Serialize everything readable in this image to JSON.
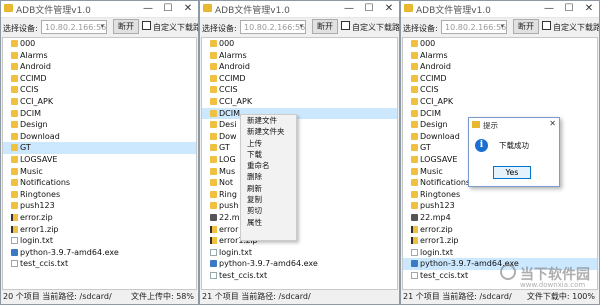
{
  "windows": [
    {
      "title": "ADB文件管理v1.0",
      "device_label": "选择设备:",
      "device_value": "10.80.2.166:5656",
      "disconnect_label": "断开",
      "custom_path_label": "自定义下载路径",
      "items": [
        {
          "name": "000",
          "type": "folder"
        },
        {
          "name": "Alarms",
          "type": "folder"
        },
        {
          "name": "Android",
          "type": "folder"
        },
        {
          "name": "CCIMD",
          "type": "folder"
        },
        {
          "name": "CCIS",
          "type": "folder"
        },
        {
          "name": "CCI_APK",
          "type": "folder"
        },
        {
          "name": "DCIM",
          "type": "folder"
        },
        {
          "name": "Design",
          "type": "folder"
        },
        {
          "name": "Download",
          "type": "folder"
        },
        {
          "name": "GT",
          "type": "folder",
          "selected": true
        },
        {
          "name": "LOGSAVE",
          "type": "folder"
        },
        {
          "name": "Music",
          "type": "folder"
        },
        {
          "name": "Notifications",
          "type": "folder"
        },
        {
          "name": "Ringtones",
          "type": "folder"
        },
        {
          "name": "push123",
          "type": "folder"
        },
        {
          "name": "error.zip",
          "type": "zip"
        },
        {
          "name": "error1.zip",
          "type": "zip"
        },
        {
          "name": "login.txt",
          "type": "txt"
        },
        {
          "name": "python-3.9.7-amd64.exe",
          "type": "exe"
        },
        {
          "name": "test_ccis.txt",
          "type": "txt"
        }
      ],
      "status_left": "20 个项目  当前路径: /sdcard/",
      "status_right": "文件上传中: 58%"
    },
    {
      "title": "ADB文件管理v1.0",
      "device_label": "选择设备:",
      "device_value": "10.80.2.166:5656",
      "disconnect_label": "断开",
      "custom_path_label": "自定义下载路径",
      "items": [
        {
          "name": "000",
          "type": "folder"
        },
        {
          "name": "Alarms",
          "type": "folder"
        },
        {
          "name": "Android",
          "type": "folder"
        },
        {
          "name": "CCIMD",
          "type": "folder"
        },
        {
          "name": "CCIS",
          "type": "folder"
        },
        {
          "name": "CCI_APK",
          "type": "folder"
        },
        {
          "name": "DCIM",
          "type": "folder",
          "selected": true
        },
        {
          "name": "Desi",
          "type": "folder"
        },
        {
          "name": "Dow",
          "type": "folder"
        },
        {
          "name": "GT",
          "type": "folder"
        },
        {
          "name": "LOG",
          "type": "folder"
        },
        {
          "name": "Mus",
          "type": "folder"
        },
        {
          "name": "Not",
          "type": "folder"
        },
        {
          "name": "Ring",
          "type": "folder"
        },
        {
          "name": "push",
          "type": "folder"
        },
        {
          "name": "22.m",
          "type": "mp4"
        },
        {
          "name": "error",
          "type": "zip"
        },
        {
          "name": "error1.zip",
          "type": "zip"
        },
        {
          "name": "login.txt",
          "type": "txt"
        },
        {
          "name": "python-3.9.7-amd64.exe",
          "type": "exe"
        },
        {
          "name": "test_ccis.txt",
          "type": "txt"
        }
      ],
      "status_left": "21 个项目  当前路径: /sdcard/",
      "status_right": ""
    },
    {
      "title": "ADB文件管理v1.0",
      "device_label": "选择设备:",
      "device_value": "10.80.2.166:5656",
      "disconnect_label": "断开",
      "custom_path_label": "自定义下载路径",
      "items": [
        {
          "name": "000",
          "type": "folder"
        },
        {
          "name": "Alarms",
          "type": "folder"
        },
        {
          "name": "Android",
          "type": "folder"
        },
        {
          "name": "CCIMD",
          "type": "folder"
        },
        {
          "name": "CCIS",
          "type": "folder"
        },
        {
          "name": "CCI_APK",
          "type": "folder"
        },
        {
          "name": "DCIM",
          "type": "folder"
        },
        {
          "name": "Design",
          "type": "folder"
        },
        {
          "name": "Download",
          "type": "folder"
        },
        {
          "name": "GT",
          "type": "folder"
        },
        {
          "name": "LOGSAVE",
          "type": "folder"
        },
        {
          "name": "Music",
          "type": "folder"
        },
        {
          "name": "Notifications",
          "type": "folder"
        },
        {
          "name": "Ringtones",
          "type": "folder"
        },
        {
          "name": "push123",
          "type": "folder"
        },
        {
          "name": "22.mp4",
          "type": "mp4"
        },
        {
          "name": "error.zip",
          "type": "zip"
        },
        {
          "name": "error1.zip",
          "type": "zip"
        },
        {
          "name": "login.txt",
          "type": "txt"
        },
        {
          "name": "python-3.9.7-amd64.exe",
          "type": "exe",
          "selected": true
        },
        {
          "name": "test_ccis.txt",
          "type": "txt"
        }
      ],
      "status_left": "21 个项目  当前路径: /sdcard/",
      "status_right": "文件下载中: 100%"
    }
  ],
  "context_menu": [
    "新建文件",
    "新建文件夹",
    "上传",
    "下载",
    "重命名",
    "删除",
    "刷新",
    "复制",
    "剪切",
    "属性"
  ],
  "dialog": {
    "title": "提示",
    "message": "下载成功",
    "ok_label": "Yes",
    "close_glyph": "✕"
  },
  "watermark": {
    "text": "当下软件园",
    "url": "www.downxia.com"
  },
  "titlebar_buttons": [
    "—",
    "☐",
    "✕"
  ],
  "colors": {
    "selection": "#cce8ff",
    "folder": "#f0c040",
    "info_icon": "#1a6fd1"
  }
}
